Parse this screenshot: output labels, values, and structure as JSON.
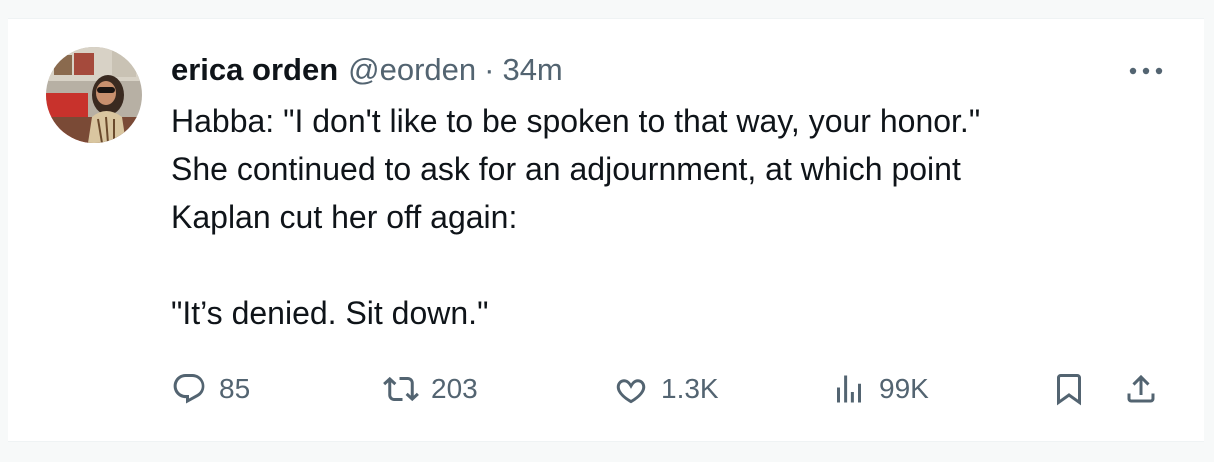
{
  "tweet": {
    "author_name": "erica orden",
    "handle": "@eorden",
    "separator": "·",
    "time": "34m",
    "paragraph1": [
      "Habba: \"I don't like to be spoken to that way, your honor.\"",
      "She continued to ask for an adjournment, at which point",
      "Kaplan cut her off again:"
    ],
    "paragraph2": "\"It’s denied. Sit down.\""
  },
  "actions": {
    "replies": "85",
    "retweets": "203",
    "likes": "1.3K",
    "views": "99K"
  },
  "icons": {
    "more": "more-dots-icon",
    "reply": "reply-icon",
    "retweet": "retweet-icon",
    "like": "heart-icon",
    "views": "views-bar-chart-icon",
    "bookmark": "bookmark-icon",
    "share": "share-icon"
  },
  "colors": {
    "text_primary": "#0f1419",
    "text_secondary": "#536471",
    "background": "#ffffff"
  }
}
